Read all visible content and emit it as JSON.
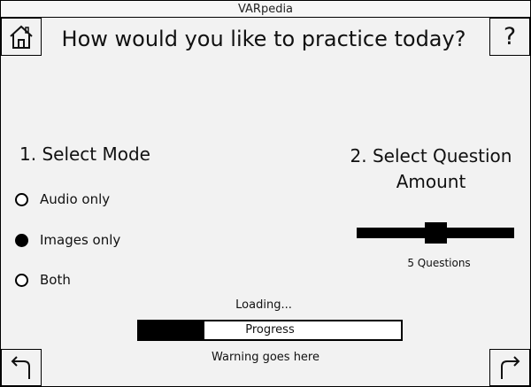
{
  "window": {
    "title": "VARpedia"
  },
  "header": {
    "title": "How would you like to practice today?",
    "home_icon": "home-icon",
    "help_label": "?"
  },
  "mode": {
    "title": "1. Select Mode",
    "options": [
      {
        "label": "Audio only",
        "selected": false
      },
      {
        "label": "Images only",
        "selected": true
      },
      {
        "label": "Both",
        "selected": false
      }
    ]
  },
  "amount": {
    "title": "2. Select Question Amount",
    "value_label": "5 Questions",
    "slider_fraction": 0.5
  },
  "status": {
    "loading": "Loading...",
    "progress_label": "Progress",
    "progress_fraction": 0.25,
    "warning": "Warning goes here"
  },
  "nav": {
    "back_icon": "back-arrow-icon",
    "next_icon": "forward-arrow-icon"
  }
}
